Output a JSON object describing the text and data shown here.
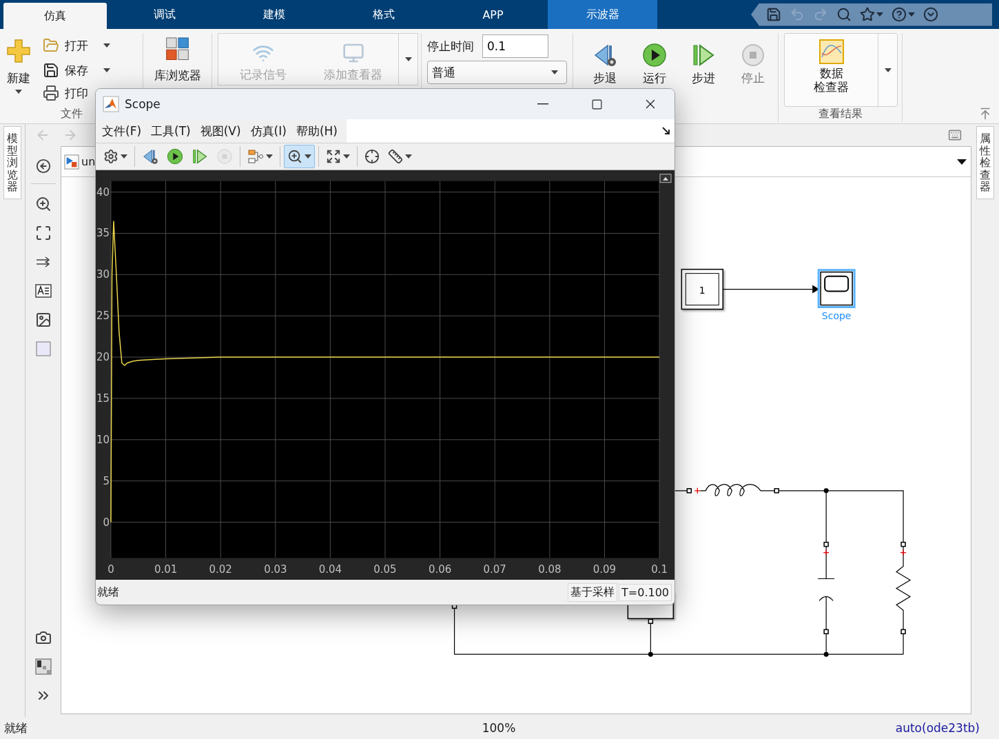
{
  "ribbon_tabs": [
    {
      "label": "仿真",
      "selected": true,
      "kind": "normal"
    },
    {
      "label": "调试",
      "selected": false,
      "kind": "normal"
    },
    {
      "label": "建模",
      "selected": false,
      "kind": "normal"
    },
    {
      "label": "格式",
      "selected": false,
      "kind": "normal"
    },
    {
      "label": "APP",
      "selected": false,
      "kind": "normal"
    },
    {
      "label": "示波器",
      "selected": false,
      "kind": "contextual"
    }
  ],
  "quick_access": [
    {
      "kind": "save",
      "disabled": false
    },
    {
      "kind": "undo",
      "disabled": true
    },
    {
      "kind": "redo",
      "disabled": true
    },
    {
      "kind": "search",
      "disabled": false
    },
    {
      "kind": "favorite",
      "disabled": false
    },
    {
      "kind": "help",
      "disabled": false
    },
    {
      "kind": "minimize",
      "disabled": false
    }
  ],
  "ribbon": {
    "file": {
      "new": "新建",
      "open": "打开",
      "save": "保存",
      "print": "打印",
      "label": "文件"
    },
    "library": "库浏览器",
    "prepare": [
      {
        "kind": "record",
        "label": "记录信号",
        "disabled": true
      },
      {
        "kind": "viewer",
        "label": "添加查看器",
        "disabled": true
      }
    ],
    "stop_time": {
      "label": "停止时间",
      "value": "0.1"
    },
    "mode": "普通",
    "sim_buttons": [
      {
        "kind": "step_back",
        "label": "步退",
        "disabled": false
      },
      {
        "kind": "run",
        "label": "运行",
        "disabled": false
      },
      {
        "kind": "step_forward",
        "label": "步进",
        "disabled": false
      },
      {
        "kind": "stop",
        "label": "停止",
        "disabled": true
      }
    ],
    "results": {
      "button": [
        "数据",
        "检查器"
      ],
      "label": "查看结果"
    }
  },
  "side_tabs": {
    "left": "模型浏览器",
    "right": "属性检查器"
  },
  "model_tab": "un",
  "diagram": {
    "constant_value": "1",
    "scope_label": "Scope"
  },
  "scope_window": {
    "title": "Scope",
    "menu": [
      "文件(F)",
      "工具(T)",
      "视图(V)",
      "仿真(I)",
      "帮助(H)"
    ],
    "toolbar": [
      {
        "kind": "settings",
        "dropdown": true,
        "pressed": false,
        "disabled": false
      },
      {
        "kind": "step_back",
        "dropdown": false,
        "pressed": false,
        "disabled": false
      },
      {
        "kind": "run",
        "dropdown": false,
        "pressed": false,
        "disabled": false
      },
      {
        "kind": "step_forward",
        "dropdown": false,
        "pressed": false,
        "disabled": false
      },
      {
        "kind": "stop",
        "dropdown": false,
        "pressed": false,
        "disabled": true
      },
      {
        "kind": "signals",
        "dropdown": true,
        "pressed": false,
        "disabled": false
      },
      {
        "kind": "zoom",
        "dropdown": true,
        "pressed": true,
        "disabled": false
      },
      {
        "kind": "fit",
        "dropdown": true,
        "pressed": false,
        "disabled": false
      },
      {
        "kind": "trigger",
        "dropdown": false,
        "pressed": false,
        "disabled": false
      },
      {
        "kind": "measure",
        "dropdown": true,
        "pressed": false,
        "disabled": false
      }
    ],
    "chart_data": {
      "type": "line",
      "x": [
        0,
        0.0002,
        0.0005,
        0.001,
        0.0015,
        0.002,
        0.0025,
        0.003,
        0.004,
        0.005,
        0.007,
        0.01,
        0.015,
        0.02,
        0.03,
        0.05,
        0.07,
        0.1
      ],
      "series": [
        {
          "color": "#e8d44d",
          "values": [
            0,
            30,
            36.5,
            30,
            23,
            19.3,
            19,
            19.3,
            19.5,
            19.6,
            19.7,
            19.8,
            19.9,
            20,
            20,
            20,
            20,
            20
          ]
        }
      ],
      "xlim": [
        0,
        0.1
      ],
      "ylim": [
        -4.33,
        41.33
      ],
      "xticks": [
        0,
        0.01,
        0.02,
        0.03,
        0.04,
        0.05,
        0.06,
        0.07,
        0.08,
        0.09,
        0.1
      ],
      "yticks": [
        0,
        5,
        10,
        15,
        20,
        25,
        30,
        35,
        40
      ],
      "grid": true
    },
    "status": "就绪",
    "sample_mode": "基于采样",
    "time": "T=0.100"
  },
  "status_bar": {
    "left": "就绪",
    "zoom": "100%",
    "solver": "auto(ode23tb)"
  }
}
